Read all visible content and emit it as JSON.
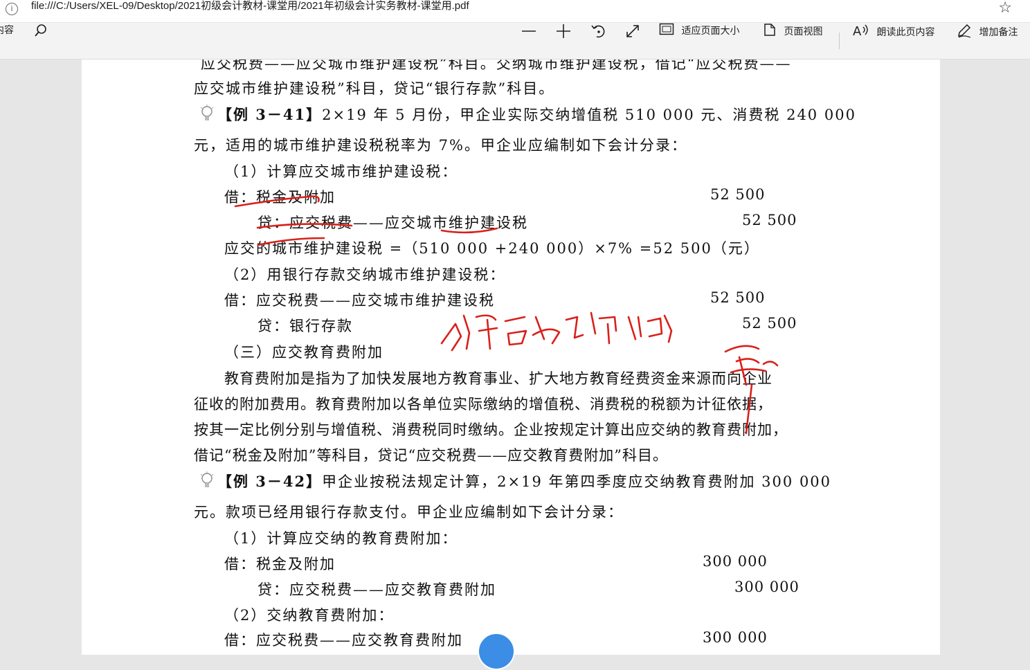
{
  "address_bar": {
    "url": "file:///C:/Users/XEL-09/Desktop/2021初级会计教材-课堂用/2021年初级会计实务教材-课堂用.pdf"
  },
  "toolbar": {
    "left_cut_label": "内容",
    "fit_page_label": "适应页面大小",
    "page_view_label": "页面视图",
    "read_aloud_label": "朗读此页内容",
    "add_note_label": "增加备注"
  },
  "document": {
    "line_top": "应交税费——应交城市维护建设税”科目。交纳城市维护建设税，借记“应交税费——",
    "line_1": "应交城市维护建设税”科目，贷记“银行存款”科目。",
    "ex41_label": "【例 3－41】",
    "ex41_text": "2×19 年 5 月份，甲企业实际交纳增值税 510 000 元、消费税 240 000",
    "ex41_text2": "元，适用的城市维护建设税税率为 7%。甲企业应编制如下会计分录：",
    "ex41_step1": "（1）计算应交城市维护建设税：",
    "ex41_debit1": "借：税金及附加",
    "ex41_debit1_amount": "52 500",
    "ex41_credit1": "贷：应交税费——应交城市维护建设税",
    "ex41_credit1_amount": "52 500",
    "ex41_formula": "应交的城市维护建设税 =（510 000 +240 000）×7% =52 500（元）",
    "ex41_step2": "（2）用银行存款交纳城市维护建设税：",
    "ex41_debit2": "借：应交税费——应交城市维护建设税",
    "ex41_debit2_amount": "52 500",
    "ex41_credit2": "贷：银行存款",
    "ex41_credit2_amount": "52 500",
    "section_3": "（三）应交教育费附加",
    "para_1": "教育费附加是指为了加快发展地方教育事业、扩大地方教育经费资金来源而向企业",
    "para_2": "征收的附加费用。教育费附加以各单位实际缴纳的增值税、消费税的税额为计征依据，",
    "para_3": "按其一定比例分别与增值税、消费税同时缴纳。企业按规定计算出应交纳的教育费附加，",
    "para_4": "借记“税金及附加”等科目，贷记“应交税费——应交教育费附加”科目。",
    "ex42_label": "【例 3－42】",
    "ex42_text": "甲企业按税法规定计算，2×19 年第四季度应交纳教育费附加 300 000",
    "ex42_text2": "元。款项已经用银行存款支付。甲企业应编制如下会计分录：",
    "ex42_step1": "（1）计算应交纳的教育费附加：",
    "ex42_debit1": "借：税金及附加",
    "ex42_debit1_amount": "300 000",
    "ex42_credit1": "贷：应交税费——应交教育费附加",
    "ex42_credit1_amount": "300 000",
    "ex42_step2": "（2）交纳教育费附加：",
    "ex42_debit2": "借：应交税费——应交教育费附加",
    "ex42_debit2_amount": "300 000"
  },
  "colors": {
    "annotation_red": "#d9201a",
    "fab_blue": "#3b8de6"
  }
}
